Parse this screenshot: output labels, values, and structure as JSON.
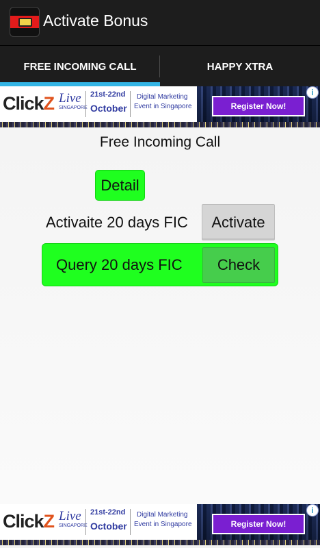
{
  "appbar": {
    "title": "Activate Bonus",
    "icon": "app-sim-icon"
  },
  "tabs": [
    {
      "label": "FREE INCOMING CALL",
      "selected": true
    },
    {
      "label": "HAPPY XTRA",
      "selected": false
    }
  ],
  "colors": {
    "appbar": "#1d1d1d",
    "tab_indicator": "#33b5e5",
    "green_button": "#1fff1f",
    "check_button": "#46cd4c",
    "activate_button": "#d5d5d5",
    "ad_register": "#7a1fd1"
  },
  "ad": {
    "brand_prefix": "Click",
    "brand_z": "Z",
    "brand_live": "Live",
    "location": "SINGAPORE",
    "dates": "21st-22nd",
    "month": "October",
    "desc_line1": "Digital Marketing",
    "desc_line2": "Event in Singapore",
    "cta": "Register Now!",
    "info": "i"
  },
  "main": {
    "title": "Free Incoming Call",
    "detail_button": "Detail",
    "activate_label": "Activaite 20 days FIC",
    "activate_button": "Activate",
    "query_label": "Query 20 days FIC",
    "check_button": "Check"
  }
}
